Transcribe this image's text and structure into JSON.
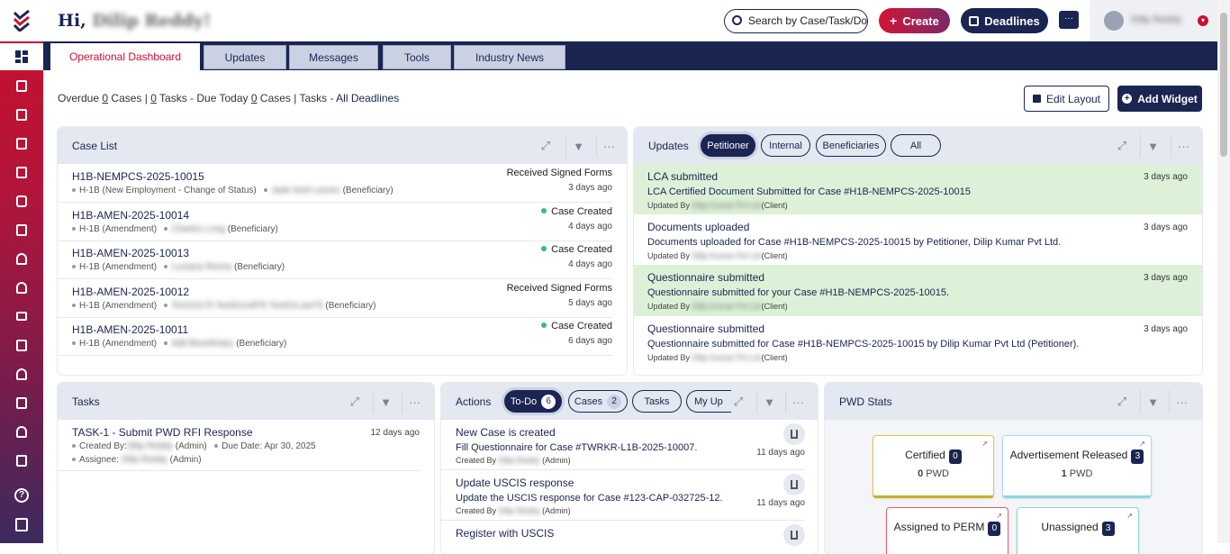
{
  "user": {
    "greeting": "Hi,",
    "name": "Dilip Reddy!",
    "short_name": "Dilip Reddy"
  },
  "header": {
    "search_placeholder": "Search by Case/Task/Document",
    "create_label": "Create",
    "deadlines_label": "Deadlines"
  },
  "tabs": [
    {
      "label": "Operational Dashboard"
    },
    {
      "label": "Updates"
    },
    {
      "label": "Messages"
    },
    {
      "label": "Tools"
    },
    {
      "label": "Industry News"
    }
  ],
  "summary": {
    "overdue_label": "Overdue",
    "overdue_cases": "0",
    "cases_word": "Cases |",
    "overdue_tasks": "0",
    "tasks_due_label": "Tasks - Due Today",
    "due_cases": "0",
    "cases_tasks_label": "Cases | Tasks -",
    "all_deadlines": "All Deadlines"
  },
  "toolbar": {
    "edit_layout": "Edit Layout",
    "add_widget": "Add Widget"
  },
  "case_list": {
    "title": "Case List",
    "rows": [
      {
        "id": "H1B-NEMPCS-2025-10015",
        "type": "H-1B (New Employment - Change of Status)",
        "person": "Jade Axel Larsen",
        "role": "(Beneficiary)",
        "status": "Received Signed Forms",
        "ago": "3 days ago",
        "dot": false
      },
      {
        "id": "H1B-AMEN-2025-10014",
        "type": "H-1B (Amendment)",
        "person": "Charles Long",
        "role": "(Beneficiary)",
        "status": "Case Created",
        "ago": "4 days ago",
        "dot": true
      },
      {
        "id": "H1B-AMEN-2025-10013",
        "type": "H-1B (Amendment)",
        "person": "Luciana Rivera",
        "role": "(Beneficiary)",
        "status": "Case Created",
        "ago": "4 days ago",
        "dot": true
      },
      {
        "id": "H1B-AMEN-2025-10012",
        "type": "H-1B (Amendment)",
        "person": "Test10175 Test01mdf75 Test01Last75",
        "role": "(Beneficiary)",
        "status": "Received Signed Forms",
        "ago": "5 days ago",
        "dot": false
      },
      {
        "id": "H1B-AMEN-2025-10011",
        "type": "H-1B (Amendment)",
        "person": "Adil Beneficiary",
        "role": "(Beneficiary)",
        "status": "Case Created",
        "ago": "6 days ago",
        "dot": true
      }
    ]
  },
  "updates": {
    "title": "Updates",
    "filters": [
      "Petitioner",
      "Internal",
      "Beneficiaries",
      "All"
    ],
    "by_label": "Updated By",
    "client_label": "(Client)",
    "rows": [
      {
        "title": "LCA submitted",
        "desc": "LCA Certified Document Submitted for Case #H1B-NEMPCS-2025-10015",
        "by": "Dilip Kumar Pvt Ltd",
        "ago": "3 days ago",
        "green": true
      },
      {
        "title": "Documents uploaded",
        "desc": "Documents uploaded for Case #H1B-NEMPCS-2025-10015 by Petitioner, Dilip Kumar Pvt Ltd.",
        "by": "Dilip Kumar Pvt Ltd",
        "ago": "3 days ago",
        "green": false
      },
      {
        "title": "Questionnaire submitted",
        "desc": "Questionnaire submitted for your Case #H1B-NEMPCS-2025-10015.",
        "by": "Dilip Kumar Pvt Ltd",
        "ago": "3 days ago",
        "green": true
      },
      {
        "title": "Questionnaire submitted",
        "desc": "Questionnaire submitted for Case #H1B-NEMPCS-2025-10015 by Dilip Kumar Pvt Ltd (Petitioner).",
        "by": "Dilip Kumar Pvt Ltd",
        "ago": "3 days ago",
        "green": false
      }
    ]
  },
  "tasks": {
    "title": "Tasks",
    "name": "TASK-1 - Submit PWD RFI Response",
    "ago": "12 days ago",
    "created_label": "Created By:",
    "created_by": "Dilip Reddy",
    "admin": "(Admin)",
    "due_label": "Due Date: Apr 30, 2025",
    "assignee_label": "Assignee:",
    "assignee": "Dilip Reddy"
  },
  "actions": {
    "title": "Actions",
    "filters": [
      {
        "label": "To-Do",
        "count": "6"
      },
      {
        "label": "Cases",
        "count": "2"
      },
      {
        "label": "Tasks",
        "count": ""
      },
      {
        "label": "My Up",
        "count": ""
      }
    ],
    "created_label": "Created By",
    "admin": "(Admin)",
    "rows": [
      {
        "title": "New Case is created",
        "desc": "Fill Questionnaire for Case #TWRKR-L1B-2025-10007.",
        "by": "Dilip Reddy",
        "ago": "11 days ago"
      },
      {
        "title": "Update USCIS response",
        "desc": "Update the USCIS response for Case #123-CAP-032725-12.",
        "by": "Dilip Reddy",
        "ago": "11 days ago"
      },
      {
        "title": "Register with USCIS",
        "desc": "",
        "by": "",
        "ago": ""
      }
    ]
  },
  "pwd_stats": {
    "title": "PWD Stats",
    "unit": "PWD",
    "cards": [
      {
        "label": "Certified",
        "count": "0",
        "value": "0"
      },
      {
        "label": "Advertisement Released",
        "count": "3",
        "value": "1"
      },
      {
        "label": "Assigned to PERM",
        "count": "0",
        "value": ""
      },
      {
        "label": "Unassigned",
        "count": "3",
        "value": ""
      }
    ]
  },
  "colors": {
    "brand_navy": "#1a2552",
    "brand_red": "#c8102e",
    "update_green": "#dcf1d8"
  }
}
